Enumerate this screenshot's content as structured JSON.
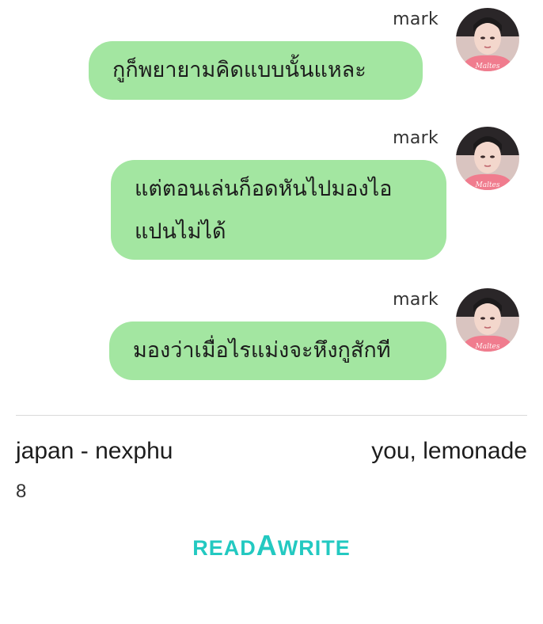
{
  "messages": [
    {
      "sender": "mark",
      "lines": [
        "กูก็พยายามคิดแบบนั้นแหละ"
      ]
    },
    {
      "sender": "mark",
      "lines": [
        "แต่ตอนเล่นก็อดหันไปมองไอ",
        "แปนไม่ได้"
      ]
    },
    {
      "sender": "mark",
      "lines": [
        "มองว่าเมื่อไรแม่งจะหึงกูสักที"
      ]
    }
  ],
  "footer": {
    "story_title": "japan - nexphu",
    "chapter_title": "you, lemonade",
    "count": "8"
  },
  "logo": {
    "prefix": "READ",
    "highlight": "A",
    "suffix": "WRITE"
  },
  "colors": {
    "bubble": "#a3e6a1",
    "logo": "#23c9c1",
    "avatar_shirt": "#f07c8e"
  },
  "icons": {
    "avatar": "profile-photo"
  }
}
